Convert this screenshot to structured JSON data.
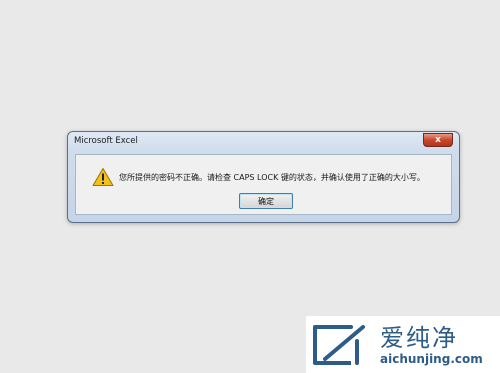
{
  "dialog": {
    "title": "Microsoft Excel",
    "close_glyph": "x",
    "message": "您所提供的密码不正确。请检查 CAPS LOCK 键的状态，并确认使用了正确的大小写。",
    "ok_label": "确定",
    "icon": "warning-icon"
  },
  "watermark": {
    "brand_cn": "爱纯净",
    "url": "aichunjing.com",
    "logo_icon": "brand-logo-icon"
  },
  "colors": {
    "background": "#e9e9e9",
    "warning_yellow": "#f2c21b",
    "close_red": "#c8482a",
    "brand_blue": "#2d5c88"
  }
}
